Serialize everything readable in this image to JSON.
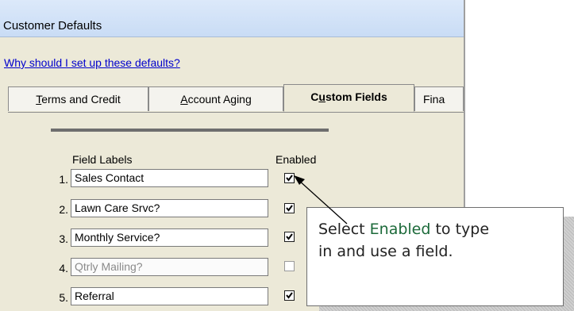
{
  "window": {
    "title": "Customer Defaults"
  },
  "help_link": "Why should I set up these defaults?",
  "tabs": [
    {
      "pre": "",
      "key": "T",
      "post": "erms and Credit"
    },
    {
      "pre": "",
      "key": "A",
      "post": "ccount Aging"
    },
    {
      "pre": "C",
      "key": "u",
      "post": "stom Fields"
    },
    {
      "pre": "",
      "key": "",
      "post": "Fina"
    }
  ],
  "headers": {
    "field_labels": "Field Labels",
    "enabled": "Enabled"
  },
  "fields": [
    {
      "num": "1.",
      "value": "Sales Contact",
      "enabled": true
    },
    {
      "num": "2.",
      "value": "Lawn Care Srvc?",
      "enabled": true
    },
    {
      "num": "3.",
      "value": "Monthly Service?",
      "enabled": true
    },
    {
      "num": "4.",
      "value": "Qtrly Mailing?",
      "enabled": false
    },
    {
      "num": "5.",
      "value": "Referral",
      "enabled": true
    }
  ],
  "callout": {
    "pre": "Select ",
    "highlight": "Enabled",
    "post": " to type",
    "line2": "in and use a field."
  }
}
